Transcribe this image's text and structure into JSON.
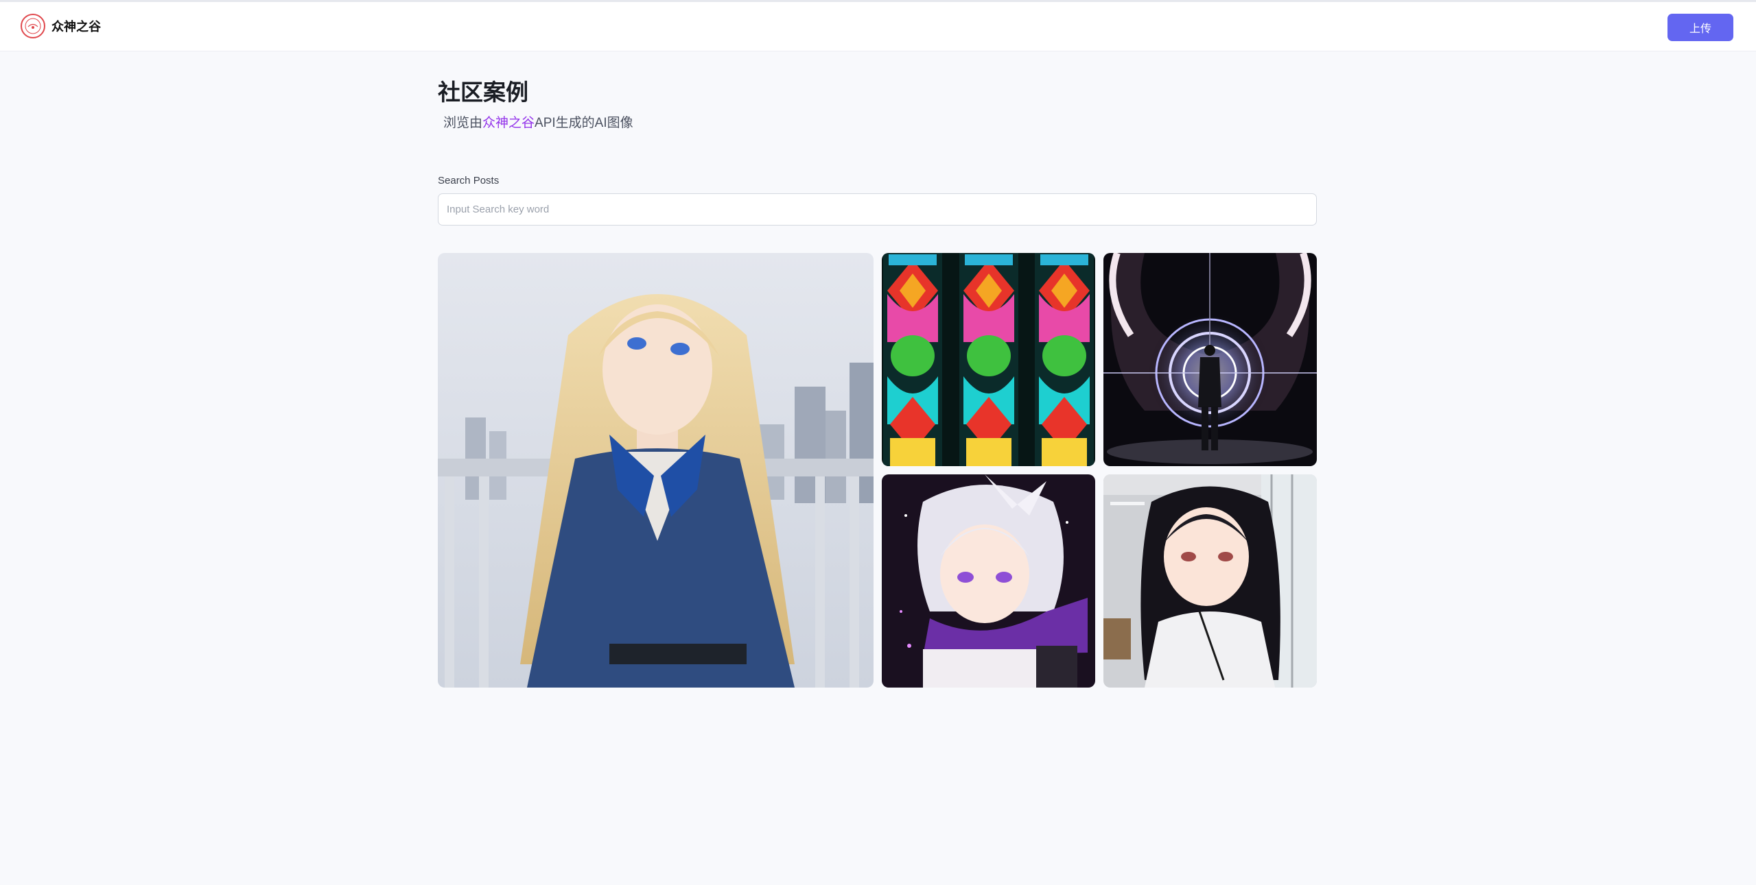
{
  "brand": {
    "name": "众神之谷",
    "logo_icon": "brand-logo-icon"
  },
  "header": {
    "upload_label": "上传"
  },
  "page": {
    "title": "社区案例",
    "subtitle_prefix": "浏览由",
    "subtitle_highlight": "众神之谷",
    "subtitle_suffix": "API生成的AI图像"
  },
  "search": {
    "label": "Search Posts",
    "placeholder": "Input Search key word",
    "value": ""
  },
  "gallery": [
    {
      "subject": "blonde anime girl with blue bow on balcony"
    },
    {
      "subject": "colorful stained glass window"
    },
    {
      "subject": "man in suit facing glowing concentric rings"
    },
    {
      "subject": "white-haired anime girl with purple scarf"
    },
    {
      "subject": "black-haired anime girl in white shirt"
    }
  ],
  "colors": {
    "accent": "#6366f1",
    "highlight": "#9333ea",
    "background": "#f8f9fc"
  }
}
